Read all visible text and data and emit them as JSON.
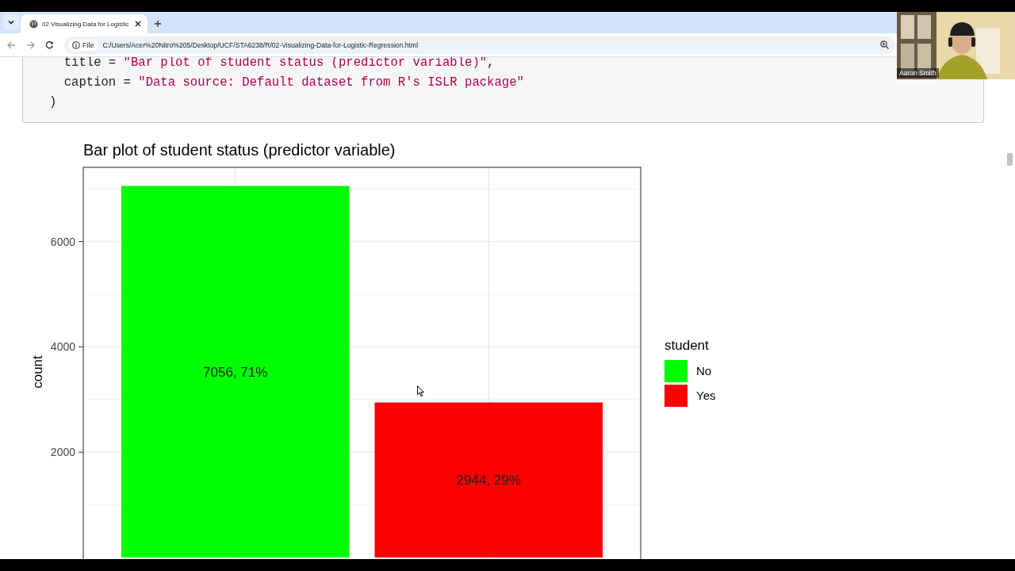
{
  "browser": {
    "tab": {
      "title": "02 Visualizing Data for Logistic"
    },
    "address": {
      "scheme": "File",
      "url": "C:/Users/Acer%20Nitro%205/Desktop/UCF/STA6238/R/02-Visualizing-Data-for-Logistic-Regression.html"
    }
  },
  "code": {
    "lines": [
      [
        {
          "kind": "plain",
          "text": "  title = "
        },
        {
          "kind": "string",
          "text": "\"Bar plot of student status (predictor variable)\""
        },
        {
          "kind": "plain",
          "text": ","
        }
      ],
      [
        {
          "kind": "plain",
          "text": "  caption = "
        },
        {
          "kind": "string",
          "text": "\"Data source: Default dataset from R's ISLR package\""
        }
      ],
      [
        {
          "kind": "plain",
          "text": ")"
        }
      ]
    ]
  },
  "chart": {
    "chart_data": {
      "type": "bar",
      "title": "Bar plot of student status (predictor variable)",
      "ylabel": "count",
      "series": [
        {
          "name": "No",
          "color": "#00ff00",
          "values": [
            7056,
            null
          ]
        },
        {
          "name": "Yes",
          "color": "#ff0000",
          "values": [
            null,
            2944
          ]
        }
      ],
      "ylim": [
        -352.8,
        7408.8
      ],
      "yticks": [
        2000,
        4000,
        6000
      ],
      "value_labels": [
        "7056, 71%",
        "2944, 29%"
      ],
      "grid": true,
      "legend": {
        "title": "student"
      }
    }
  },
  "video_overlay": {
    "kind": "picture",
    "name": "Aaron Smith"
  }
}
